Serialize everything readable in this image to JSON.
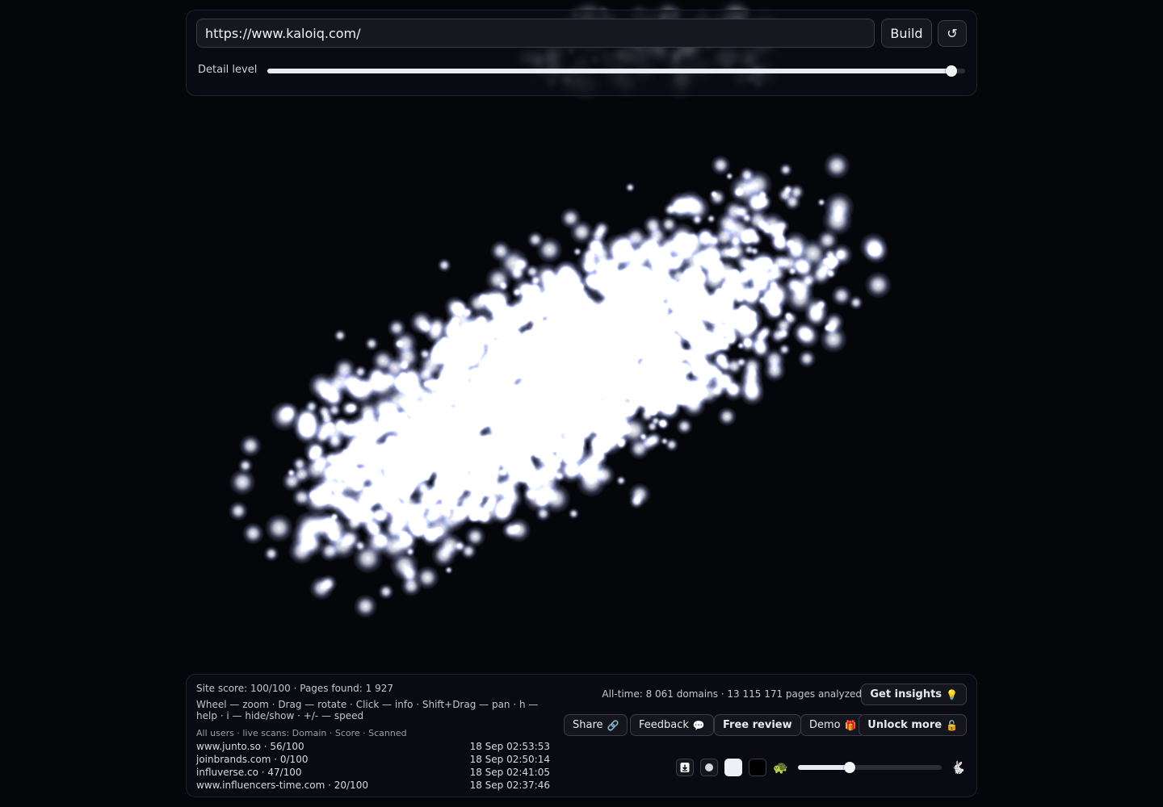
{
  "top_bar": {
    "url": "https://www.kaloiq.com/",
    "build_label": "Build",
    "reset_icon": "↺",
    "detail_label": "Detail level",
    "detail_level_fraction": 0.98
  },
  "stats": {
    "site": "Site score: 100/100 · Pages found: 1 927",
    "controls_help": "Wheel — zoom · Drag — rotate · Click — info · Shift+Drag — pan · h — help · i — hide/show · +/- — speed",
    "scans_header": "All users · live scans: Domain · Score · Scanned",
    "all_time": "All-time: 8 061 domains · 13 115 171 pages analyzed"
  },
  "scans": [
    {
      "domain": "www.junto.so · 56/100",
      "time": "18 Sep 02:53:53"
    },
    {
      "domain": "joinbrands.com · 0/100",
      "time": "18 Sep 02:50:14"
    },
    {
      "domain": "influverse.co · 47/100",
      "time": "18 Sep 02:41:05"
    },
    {
      "domain": "www.influencers-time.com · 20/100",
      "time": "18 Sep 02:37:46"
    }
  ],
  "buttons": {
    "insights": {
      "label": "Get insights",
      "icon": "💡"
    },
    "share": {
      "label": "Share",
      "icon": "🔗"
    },
    "feedback": {
      "label": "Feedback",
      "icon": "💬"
    },
    "review": {
      "label": "Free review"
    },
    "demo": {
      "label": "Demo",
      "icon": "🎁"
    },
    "unlock": {
      "label": "Unlock more",
      "icon": "🔓"
    }
  },
  "playback": {
    "turtle_icon": "🐢",
    "rabbit_icon": "🐇",
    "speed_fraction": 0.36,
    "download_icon": "download-icon",
    "dot_icon": "dot-icon"
  },
  "colors": {
    "background": "#05060a",
    "particle": "#ffffff",
    "glow": "#b9c2ff"
  }
}
